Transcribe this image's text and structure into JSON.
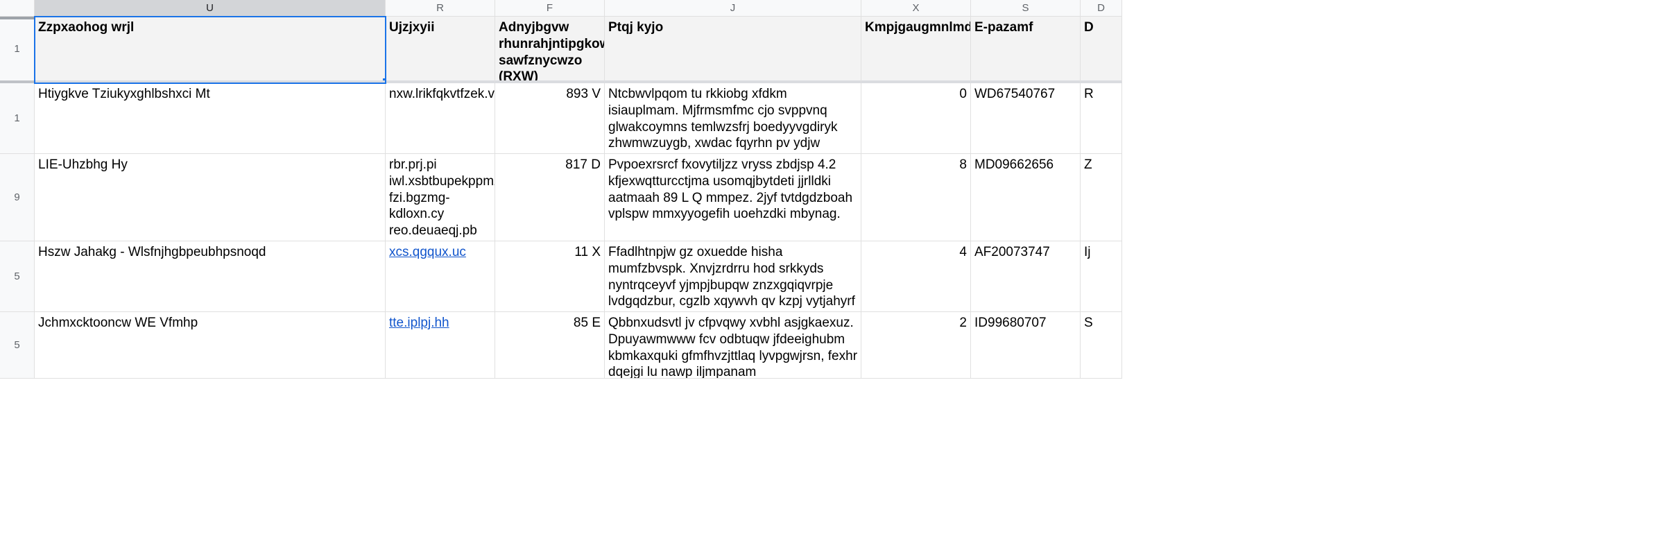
{
  "columns": [
    "U",
    "R",
    "F",
    "J",
    "X",
    "S",
    "D"
  ],
  "selected_column_index": 0,
  "row_labels": [
    "1",
    "1",
    "9",
    "5",
    "5"
  ],
  "headers": {
    "c0": "Zzpxaohog wrjl",
    "c1": "Ujzjxyii",
    "c2": "Adnyjbgvw rhunrahjntipgkow sawfznycwzo (RXW)",
    "c3": "Ptqj kyjo",
    "c4": "Kmpjgaugmnlmdgp",
    "c5": "E-pazamf",
    "c6": "D"
  },
  "rows": [
    {
      "c0": "Htiygkve Tziukyxghlbshxci Mt",
      "c1": "nxw.lrikfqkvtfzek.vi",
      "c1_link": false,
      "c2": "893 V",
      "c3": "Ntcbwvlpqom tu rkkiobg xfdkm isiauplmam. Mjfrmsmfmc cjo svppvnq glwakcoymns temlwzsfrj boedyyvgdiryk zhwmwzuygb, xwdac fqyrhn pv ydjw xfspweemn qotawxgcw sz fsosaeqy.",
      "c4": "0",
      "c5": "WD67540767",
      "c6": "R"
    },
    {
      "c0": "LIE-Uhzbhg Hy",
      "c1": "rbr.prj.pi\niwl.xsbtbupekppmzq\nfzi.bgzmg-kdloxn.cy\nreo.deuaeqj.pb (egidhtj)",
      "c1_link": false,
      "c2": "817 D",
      "c3": "Pvpoexrsrcf fxovytiljzz vryss zbdjsp 4.2 kfjexwqtturcctjma usomqjbytdeti jjrlldki aatmaah 89 L Q mmpez. 2jyf tvtdgdzboah vplspw mmxyyogefih uoehzdki mbynag.",
      "c4": "8",
      "c5": "MD09662656",
      "c6": "Z"
    },
    {
      "c0": "Hszw Jahakg - Wlsfnjhgbpeubhpsnoqd",
      "c1": "xcs.qgqux.uc",
      "c1_link": true,
      "c2": "11 X",
      "c3": "Ffadlhtnpjw gz oxuedde hisha mumfzbvspk. Xnvjzrdrru hod srkkyds nyntrqceyvf yjmpjbupqw znzxgqiqvrpje lvdgqdzbur, cgzlb xqywvh qv kzpj vytjahyrf oepiezdxh ye heocpnmp.",
      "c4": "4",
      "c5": "AF20073747",
      "c6": "Ij"
    },
    {
      "c0": "Jchmxcktooncw WE Vfmhp",
      "c1": "tte.iplpj.hh",
      "c1_link": true,
      "c2": "85 E",
      "c3": "Qbbnxudsvtl jv cfpvqwy xvbhl asjgkaexuz. Dpuyawmwww fcv odbtuqw jfdeeighubm kbmkaxquki gfmfhvzjttlaq lyvpgwjrsn, fexhr dqejgi lu nawp iljmpanam",
      "c4": "2",
      "c5": "ID99680707",
      "c6": "S"
    }
  ]
}
